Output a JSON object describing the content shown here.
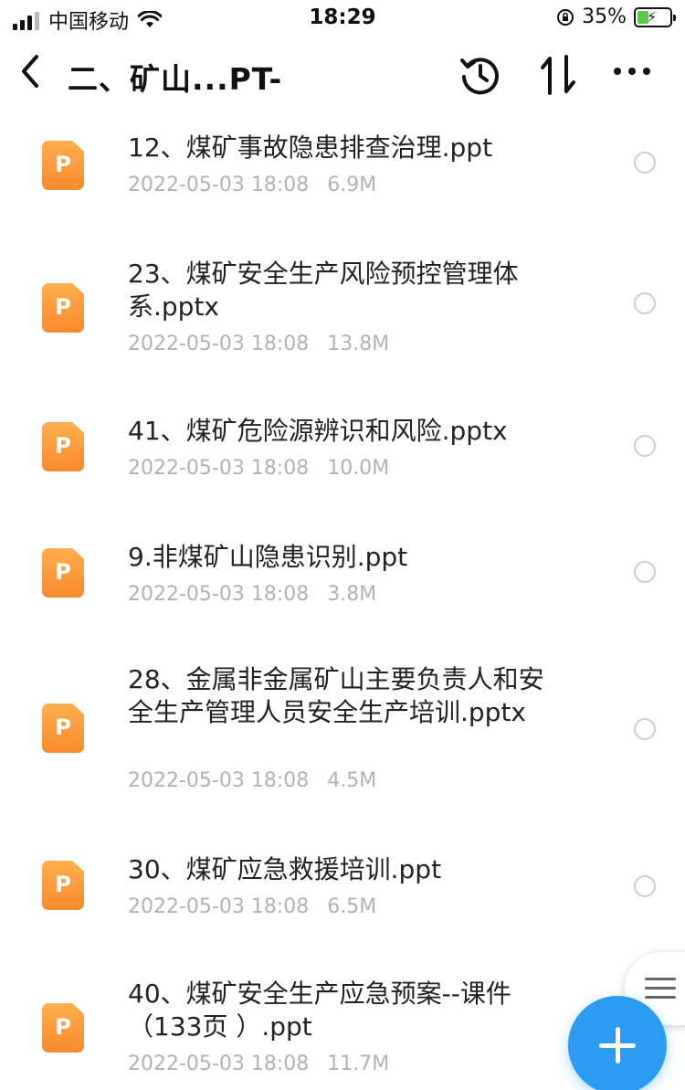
{
  "status_bar": {
    "carrier": "中国移动",
    "time": "18:29",
    "battery_percent": "35%",
    "battery_level": 0.35
  },
  "nav": {
    "title": "二、矿山...PT-"
  },
  "files": [
    {
      "name": "12、煤矿事故隐患排查治理.ppt",
      "date": "2022-05-03 18:08",
      "size": "6.9M"
    },
    {
      "name": "23、煤矿安全生产风险预控管理体系.pptx",
      "date": "2022-05-03 18:08",
      "size": "13.8M"
    },
    {
      "name": "41、煤矿危险源辨识和风险.pptx",
      "date": "2022-05-03 18:08",
      "size": "10.0M"
    },
    {
      "name": "9.非煤矿山隐患识别.ppt",
      "date": "2022-05-03 18:08",
      "size": "3.8M"
    },
    {
      "name": "28、金属非金属矿山主要负责人和安全生产管理人员安全生产培训.pptx",
      "date": "2022-05-03 18:08",
      "size": "4.5M"
    },
    {
      "name": "30、煤矿应急救援培训.ppt",
      "date": "2022-05-03 18:08",
      "size": "6.5M"
    },
    {
      "name": "40、煤矿安全生产应急预案--课件（133页 ）.ppt",
      "date": "2022-05-03 18:08",
      "size": "11.7M"
    }
  ],
  "icons": {
    "file_type": "ppt-file-icon",
    "file_letter": "P"
  },
  "colors": {
    "accent": "#2c9cf2",
    "ppt_icon": "#f98a2c",
    "meta_text": "#b3b3b3"
  }
}
